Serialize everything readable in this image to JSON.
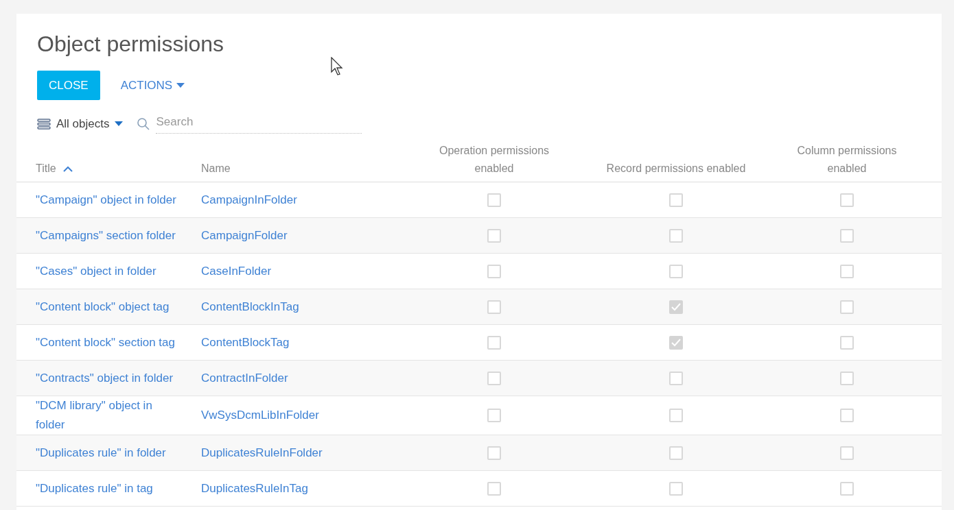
{
  "page": {
    "title": "Object permissions"
  },
  "toolbar": {
    "close_button": "CLOSE",
    "actions_button": "ACTIONS"
  },
  "filter": {
    "dropdown": "All objects",
    "search": {
      "placeholder": "Search"
    }
  },
  "table": {
    "columns": [
      {
        "label": "Title",
        "sorted": true
      },
      {
        "label": "Name",
        "sorted": false
      },
      {
        "label": "Operation permissions enabled",
        "sorted": false
      },
      {
        "label": "Record permissions enabled",
        "sorted": false
      },
      {
        "label": "Column permissions enabled",
        "sorted": false
      }
    ],
    "rows": [
      {
        "title": "\"Campaign\" object in folder",
        "name": "CampaignInFolder",
        "operation": false,
        "record": false,
        "column": false
      },
      {
        "title": "\"Campaigns\" section folder",
        "name": "CampaignFolder",
        "operation": false,
        "record": false,
        "column": false
      },
      {
        "title": "\"Cases\" object in folder",
        "name": "CaseInFolder",
        "operation": false,
        "record": false,
        "column": false
      },
      {
        "title": "\"Content block\" object tag",
        "name": "ContentBlockInTag",
        "operation": false,
        "record": true,
        "column": false
      },
      {
        "title": "\"Content block\" section tag",
        "name": "ContentBlockTag",
        "operation": false,
        "record": true,
        "column": false
      },
      {
        "title": "\"Contracts\" object in folder",
        "name": "ContractInFolder",
        "operation": false,
        "record": false,
        "column": false
      },
      {
        "title": "\"DCM library\" object in\nfolder",
        "name": "VwSysDcmLibInFolder",
        "operation": false,
        "record": false,
        "column": false
      },
      {
        "title": "\"Duplicates rule\" in folder",
        "name": "DuplicatesRuleInFolder",
        "operation": false,
        "record": false,
        "column": false
      },
      {
        "title": "\"Duplicates rule\" in tag",
        "name": "DuplicatesRuleInTag",
        "operation": false,
        "record": false,
        "column": false
      }
    ]
  }
}
